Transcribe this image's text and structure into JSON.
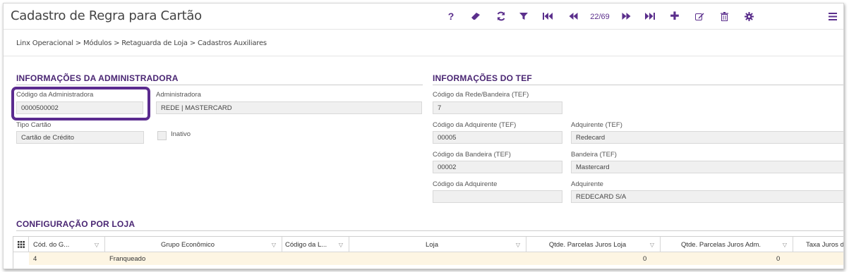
{
  "window": {
    "title": "Cadastro de Regra para Cartão"
  },
  "toolbar": {
    "help_icon": "question-icon",
    "clear_icon": "eraser-icon",
    "refresh_icon": "refresh-icon",
    "filter_icon": "filter-icon",
    "first_icon": "first-page-icon",
    "prev_icon": "previous-page-icon",
    "page_indicator": "22/69",
    "next_icon": "next-page-icon",
    "last_icon": "last-page-icon",
    "add_icon": "plus-icon",
    "edit_icon": "edit-icon",
    "delete_icon": "trash-icon",
    "settings_icon": "gear-icon",
    "menu_icon": "hamburger-icon",
    "accent_color": "#5b2f8c"
  },
  "breadcrumb": {
    "text": "Linx Operacional  >  Módulos  >  Retaguarda de Loja  >  Cadastros Auxiliares"
  },
  "admin_section": {
    "title": "INFORMAÇÕES DA ADMINISTRADORA",
    "codigo_label": "Código da Administradora",
    "codigo_value": "0000500002",
    "administradora_label": "Administradora",
    "administradora_value": "REDE | MASTERCARD",
    "tipo_label": "Tipo Cartão",
    "tipo_value": "Cartão de Crédito",
    "inativo_label": "Inativo",
    "inativo_checked": false
  },
  "tef_section": {
    "title": "INFORMAÇÕES DO TEF",
    "rede_label": "Código da Rede/Bandeira (TEF)",
    "rede_value": "7",
    "cod_adq_tef_label": "Código da Adquirente (TEF)",
    "cod_adq_tef_value": "00005",
    "adq_tef_label": "Adquirente (TEF)",
    "adq_tef_value": "Redecard",
    "cod_band_tef_label": "Código da Bandeira (TEF)",
    "cod_band_tef_value": "00002",
    "band_tef_label": "Bandeira (TEF)",
    "band_tef_value": "Mastercard",
    "cod_adq_label": "Código da Adquirente",
    "cod_adq_value": "",
    "adq_label": "Adquirente",
    "adq_value": "REDECARD S/A"
  },
  "config_section": {
    "title": "CONFIGURAÇÃO POR LOJA",
    "columns": [
      "Cód. do G...",
      "Grupo Econômico",
      "Código da L...",
      "Loja",
      "Qtde. Parcelas Juros Loja",
      "Qtde. Parcelas Juros Adm.",
      "Taxa Juros de"
    ],
    "rows": [
      [
        "4",
        "Franqueado",
        "",
        "",
        "0",
        "0",
        ""
      ]
    ],
    "row_highlight_color": "#fdf5e3"
  }
}
